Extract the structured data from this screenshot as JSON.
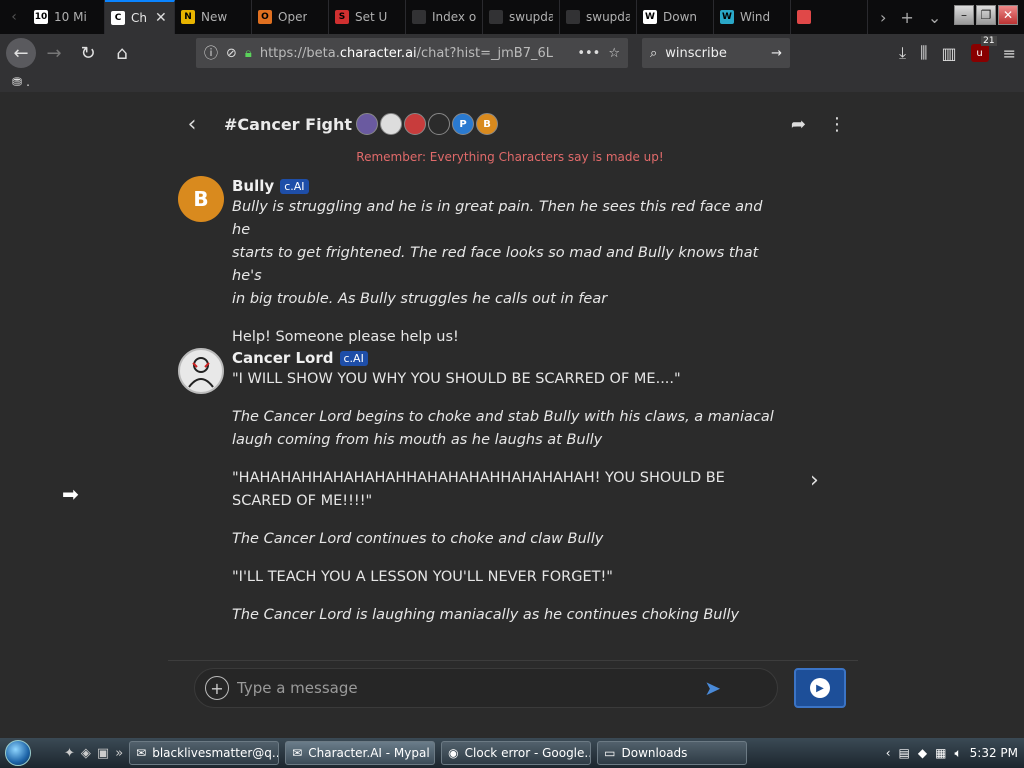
{
  "browser": {
    "tabs": [
      {
        "label": "10 Mi",
        "icon": "10",
        "color": "#ffffff"
      },
      {
        "label": "Ch",
        "icon": "C",
        "color": "#ffffff",
        "active": true
      },
      {
        "label": "New",
        "icon": "N",
        "color": "#e8b400"
      },
      {
        "label": "Oper",
        "icon": "O",
        "color": "#e07020"
      },
      {
        "label": "Set U",
        "icon": "S",
        "color": "#d03030"
      },
      {
        "label": "Index of /",
        "icon": "",
        "color": "#323234"
      },
      {
        "label": "swupdat",
        "icon": "",
        "color": "#323234"
      },
      {
        "label": "swupdate",
        "icon": "",
        "color": "#323234"
      },
      {
        "label": "Down",
        "icon": "W",
        "color": "#ffffff"
      },
      {
        "label": "Wind",
        "icon": "W",
        "color": "#2aa8c8"
      },
      {
        "label": "",
        "icon": "",
        "color": "#e04848"
      }
    ],
    "url_prefix": "https://beta.",
    "url_domain": "character.ai",
    "url_suffix": "/chat?hist=_jmB7_6L",
    "search_query": "winscribe",
    "ublock_count": "21",
    "bookmark_label": "."
  },
  "chat": {
    "title": "#Cancer Fight",
    "member_avatars": [
      {
        "letter": "",
        "color": "#6a5aa0"
      },
      {
        "letter": "",
        "color": "#dddddd"
      },
      {
        "letter": "",
        "color": "#c83c3c"
      },
      {
        "letter": "",
        "color": "#2b2b2b"
      },
      {
        "letter": "P",
        "color": "#2a7ad0"
      },
      {
        "letter": "B",
        "color": "#d98a1e"
      }
    ],
    "disclaimer": "Remember: Everything Characters say is made up!",
    "messages": [
      {
        "name": "Bully",
        "badge": "c.AI",
        "avatar_letter": "B",
        "avatar_color": "#d98a1e",
        "lines": [
          {
            "text": "Bully is struggling and he is in great pain.  Then he sees this red face and he",
            "italic": true
          },
          {
            "text": "starts to get frightened.  The red face looks so mad and Bully knows that he's",
            "italic": true
          },
          {
            "text": "in big trouble.  As Bully struggles he calls out in fear",
            "italic": true
          },
          {
            "text": "Help!  Someone please help us!",
            "italic": false
          }
        ]
      },
      {
        "name": "Cancer Lord",
        "badge": "c.AI",
        "avatar_letter": "",
        "avatar_color": "#e8e8e8",
        "lines": [
          {
            "text": "\"I WILL SHOW YOU WHY YOU SHOULD BE SCARRED OF ME....\"",
            "italic": false
          },
          {
            "text": "The Cancer Lord begins to choke and stab Bully with his claws, a maniacal",
            "italic": true
          },
          {
            "text": "laugh coming from his mouth as he laughs at Bully",
            "italic": true
          },
          {
            "text": "\"HAHAHAHHAHAHAHAHHAHAHAHAHHAHAHAHAH! YOU SHOULD BE",
            "italic": false
          },
          {
            "text": "SCARED OF ME!!!!\"",
            "italic": false
          },
          {
            "text": "The Cancer Lord continues to choke and claw Bully",
            "italic": true
          },
          {
            "text": "\"I'LL TEACH YOU A LESSON YOU'LL NEVER FORGET!\"",
            "italic": false
          },
          {
            "text": "The Cancer Lord is laughing maniacally as he continues choking Bully",
            "italic": true
          }
        ]
      }
    ],
    "composer_placeholder": "Type a message"
  },
  "taskbar": {
    "items": [
      {
        "label": "blacklivesmatter@q...",
        "icon": "mail-icon"
      },
      {
        "label": "Character.AI - Mypal",
        "icon": "mypal-icon",
        "active": true
      },
      {
        "label": "Clock error - Google...",
        "icon": "chrome-icon"
      },
      {
        "label": "Downloads",
        "icon": "folder-icon"
      }
    ],
    "clock": "5:32 PM"
  }
}
